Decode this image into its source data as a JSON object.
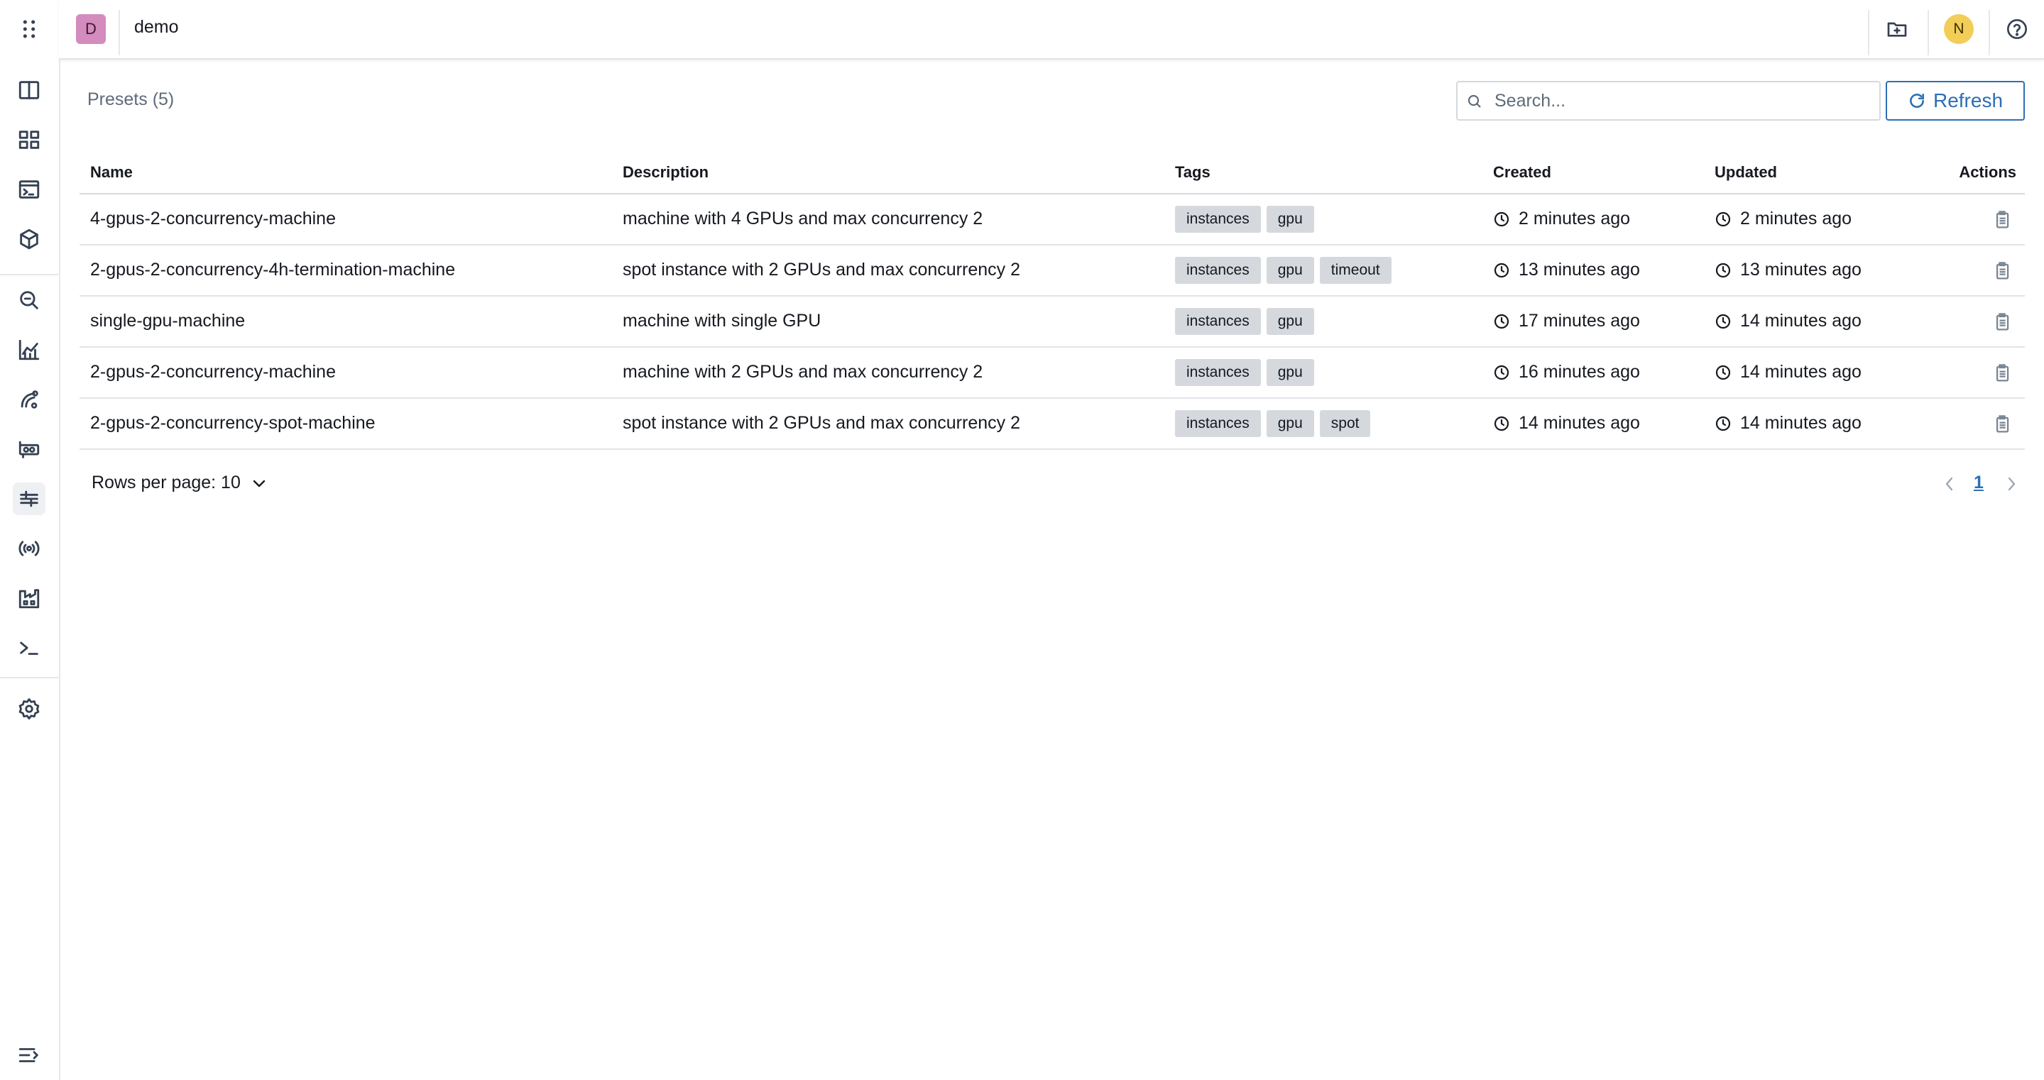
{
  "header": {
    "project_initial": "D",
    "project_name": "demo",
    "user_initial": "N"
  },
  "sidebar": {
    "icons": [
      "apps-grid-icon",
      "layout-panels-icon",
      "dashboard-icon",
      "terminal-window-icon",
      "package-icon",
      "search-zoom-icon",
      "metrics-chart-icon",
      "fleet-icon",
      "gpu-card-icon",
      "presets-icon",
      "signal-icon",
      "factory-icon",
      "console-prompt-icon",
      "settings-gear-icon",
      "collapse-menu-icon"
    ],
    "active": "presets-icon"
  },
  "page": {
    "title": "Presets (5)",
    "search_placeholder": "Search...",
    "refresh_label": "Refresh"
  },
  "table": {
    "columns": [
      "Name",
      "Description",
      "Tags",
      "Created",
      "Updated",
      "Actions"
    ],
    "rows": [
      {
        "name": "4-gpus-2-concurrency-machine",
        "description": "machine with 4 GPUs and max concurrency 2",
        "tags": [
          "instances",
          "gpu"
        ],
        "created": "2 minutes ago",
        "updated": "2 minutes ago"
      },
      {
        "name": "2-gpus-2-concurrency-4h-termination-machine",
        "description": "spot instance with 2 GPUs and max concurrency 2",
        "tags": [
          "instances",
          "gpu",
          "timeout"
        ],
        "created": "13 minutes ago",
        "updated": "13 minutes ago"
      },
      {
        "name": "single-gpu-machine",
        "description": "machine with single GPU",
        "tags": [
          "instances",
          "gpu"
        ],
        "created": "17 minutes ago",
        "updated": "14 minutes ago"
      },
      {
        "name": "2-gpus-2-concurrency-machine",
        "description": "machine with 2 GPUs and max concurrency 2",
        "tags": [
          "instances",
          "gpu"
        ],
        "created": "16 minutes ago",
        "updated": "14 minutes ago"
      },
      {
        "name": "2-gpus-2-concurrency-spot-machine",
        "description": "spot instance with 2 GPUs and max concurrency 2",
        "tags": [
          "instances",
          "gpu",
          "spot"
        ],
        "created": "14 minutes ago",
        "updated": "14 minutes ago"
      }
    ]
  },
  "pagination": {
    "rows_per_page_label": "Rows per page: 10",
    "current_page": "1"
  }
}
